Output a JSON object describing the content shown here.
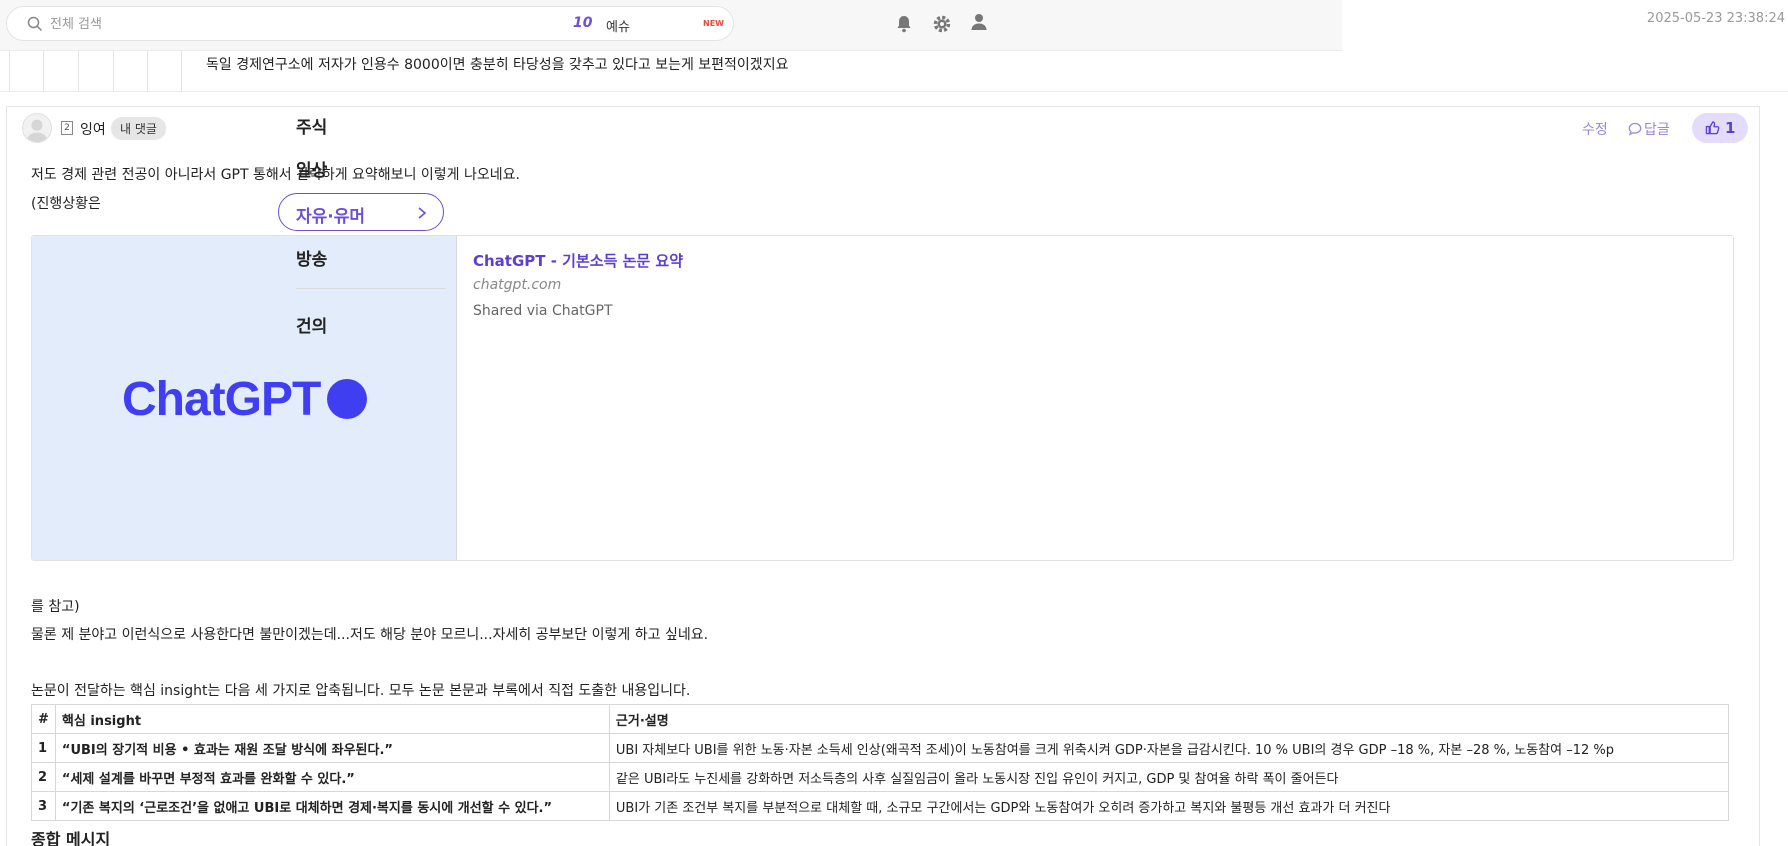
{
  "header": {
    "search_placeholder": "전체 검색",
    "trend_rank": "10",
    "trend_word": "예슈",
    "trend_badge": "NEW",
    "icons": [
      "bell-icon",
      "gear-icon",
      "user-icon"
    ],
    "timestamp": "2025-05-23 23:38:24"
  },
  "previous_comment": {
    "text": "독일 경제연구소에 저자가 인용수 8000이면 충분히 타당성을 갖추고 있다고 보는게 보편적이겠지요"
  },
  "categories": {
    "items": [
      "주식",
      "일상",
      "자유·유머",
      "방송",
      "건의"
    ],
    "active": "자유·유머"
  },
  "comment": {
    "level": "2",
    "author": "잉여",
    "my_badge": "내 댓글",
    "edit_label": "수정",
    "reply_label": "답글",
    "like_count": "1",
    "line1": "저도 경제 관련 전공이 아니라서 GPT 통해서 간략하게 요약해보니 이렇게 나오네요.",
    "line2": "(진행상황은",
    "line3": "를 참고)",
    "line4": "물론 제 분야고 이런식으로 사용한다면 불만이겠는데...저도 해당 분야 모르니...자세히 공부보단 이렇게 하고 싶네요.",
    "line5": "논문이 전달하는 핵심 insight는 다음 세 가지로 압축됩니다. 모두 논문 본문과 부록에서 직접 도출한 내용입니다.",
    "summary_heading": "종합 메시지"
  },
  "link_preview": {
    "brand": "ChatGPT",
    "title": "ChatGPT - 기본소득 논문 요약",
    "domain": "chatgpt.com",
    "description": "Shared via ChatGPT"
  },
  "table": {
    "headers": [
      "#",
      "핵심 insight",
      "근거·설명"
    ],
    "rows": [
      {
        "num": "1",
        "insight": "“UBI의 장기적 비용 • 효과는 재원 조달 방식에 좌우된다.”",
        "detail": "UBI 자체보다 UBI를 위한 노동·자본 소득세 인상(왜곡적 조세)이 노동참여를 크게 위축시켜 GDP·자본을 급감시킨다. 10 % UBI의 경우 GDP –18 %, 자본 –28 %, 노동참여 –12 %p"
      },
      {
        "num": "2",
        "insight": "“세제 설계를 바꾸면 부정적 효과를 완화할 수 있다.”",
        "detail": "같은 UBI라도 누진세를 강화하면 저소득층의 사후 실질임금이 올라 노동시장 진입 유인이 커지고, GDP 및 참여율 하락 폭이 줄어든다"
      },
      {
        "num": "3",
        "insight": "“기존 복지의 ‘근로조건’을 없애고 UBI로 대체하면 경제·복지를 동시에 개선할 수 있다.”",
        "detail": "UBI가 기존 조건부 복지를 부분적으로 대체할 때, 소규모 구간에서는 GDP와 노동참여가 오히려 증가하고 복지와 불평등 개선 효과가 더 커진다"
      }
    ]
  }
}
